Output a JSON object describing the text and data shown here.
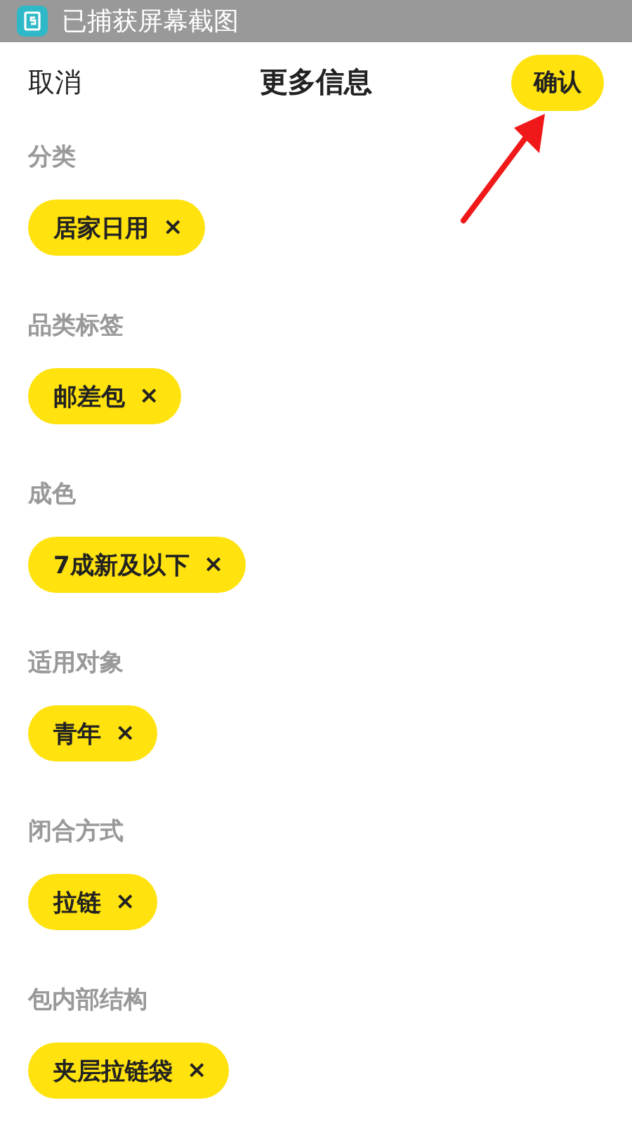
{
  "notification": {
    "text": "已捕获屏幕截图"
  },
  "nav": {
    "cancel": "取消",
    "title": "更多信息",
    "confirm": "确认"
  },
  "sections": [
    {
      "label": "分类",
      "tags": [
        {
          "text": "居家日用",
          "remove": "×"
        }
      ]
    },
    {
      "label": "品类标签",
      "tags": [
        {
          "text": "邮差包",
          "remove": "×"
        }
      ]
    },
    {
      "label": "成色",
      "tags": [
        {
          "text": "7成新及以下",
          "remove": "×"
        }
      ]
    },
    {
      "label": "适用对象",
      "tags": [
        {
          "text": "青年",
          "remove": "×"
        }
      ]
    },
    {
      "label": "闭合方式",
      "tags": [
        {
          "text": "拉链",
          "remove": "×"
        }
      ]
    },
    {
      "label": "包内部结构",
      "tags": [
        {
          "text": "夹层拉链袋",
          "remove": "×"
        }
      ]
    }
  ]
}
